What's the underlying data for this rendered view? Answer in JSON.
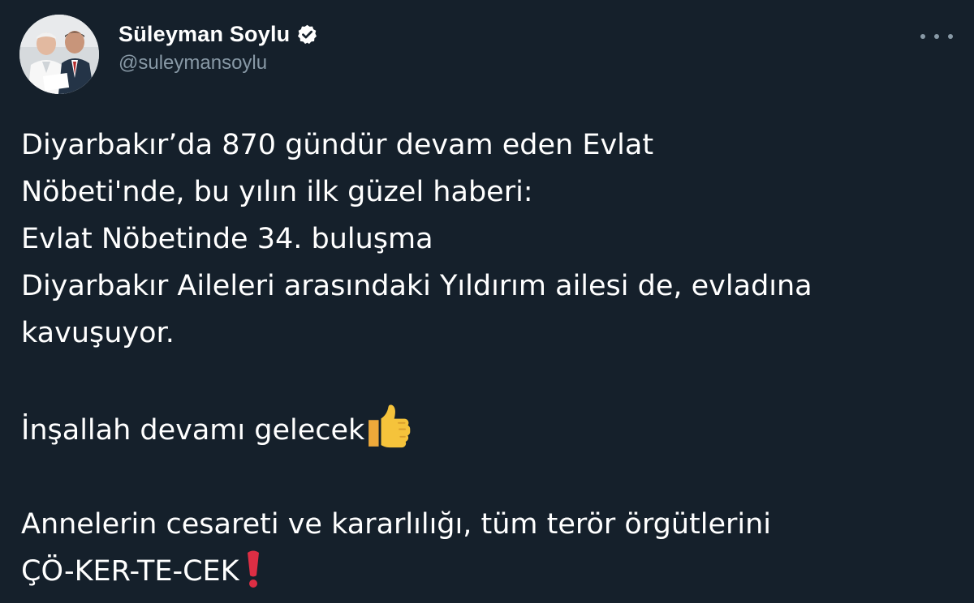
{
  "author": {
    "display_name": "Süleyman Soylu",
    "handle": "@suleymansoylu",
    "verified": true
  },
  "icons": {
    "verified": "verified-badge-icon",
    "more": "more-options-icon",
    "thumbs_up": "thumbs-up-emoji",
    "exclamation": "red-exclamation-emoji"
  },
  "colors": {
    "background": "#15202b",
    "text": "#ffffff",
    "secondary_text": "#8899a6",
    "emoji_yellow": "#f5c33b",
    "emoji_red": "#dd2e44"
  },
  "tweet": {
    "lines": [
      "Diyarbakır’da 870 gündür devam eden Evlat",
      "Nöbeti'nde, bu yılın ilk güzel haberi:",
      "Evlat Nöbetinde 34. buluşma",
      "Diyarbakır Aileleri arasındaki Yıldırım ailesi de, evladına",
      "kavuşuyor."
    ],
    "line_inshallah": "İnşallah devamı gelecek",
    "line_mothers": "Annelerin cesareti ve kararlılığı, tüm terör örgütlerini",
    "line_final": "ÇÖ-KER-TE-CEK"
  }
}
